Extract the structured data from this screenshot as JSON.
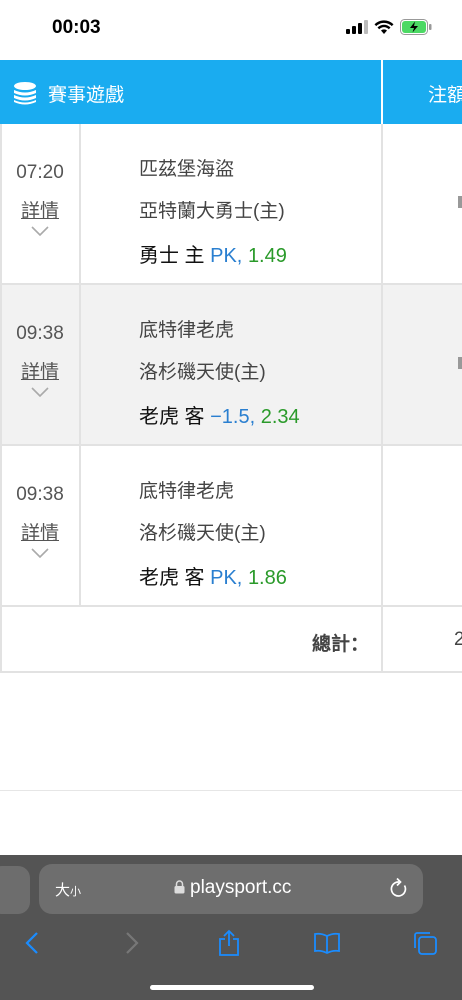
{
  "status": {
    "time": "00:03"
  },
  "table": {
    "header_title": "賽事遊戲",
    "header_col2": "注額",
    "rows": [
      {
        "time": "07:20",
        "detail": "詳情",
        "team1": "匹茲堡海盜",
        "team2": "亞特蘭大勇士(主)",
        "pick_team": "勇士 主",
        "pick_line": "PK,",
        "pick_odds": "1.49"
      },
      {
        "time": "09:38",
        "detail": "詳情",
        "team1": "底特律老虎",
        "team2": "洛杉磯天使(主)",
        "pick_team": "老虎 客",
        "pick_line": "−1.5,",
        "pick_odds": "2.34"
      },
      {
        "time": "09:38",
        "detail": "詳情",
        "team1": "底特律老虎",
        "team2": "洛杉磯天使(主)",
        "pick_team": "老虎 客",
        "pick_line": "PK,",
        "pick_odds": "1.86"
      }
    ],
    "total_label": "總計：",
    "total_value": "2"
  },
  "browser": {
    "text_size_label": "大",
    "text_size_small": "小",
    "url": "playsport.cc"
  },
  "icons": {
    "header": "coin-stack-icon",
    "chevron": "chevron-down-icon",
    "lock": "lock-icon",
    "reload": "reload-icon",
    "back": "back-icon",
    "forward": "forward-icon",
    "share": "share-icon",
    "bookmarks": "bookmarks-icon",
    "tabs": "tabs-icon"
  },
  "colors": {
    "header_bg": "#1aacf0",
    "line": "#2a7fd0",
    "odds": "#2a9a2a",
    "browser_bg": "#545454"
  }
}
